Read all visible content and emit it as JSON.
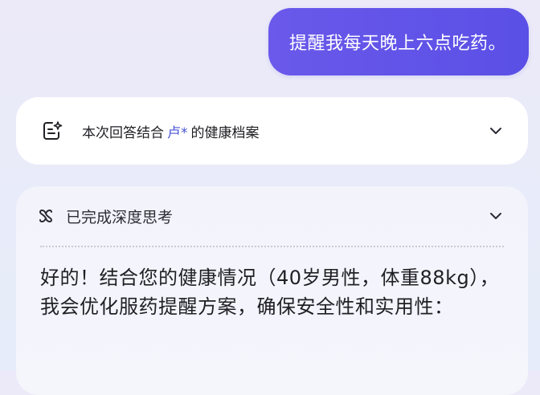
{
  "user_message": {
    "text": "提醒我每天晚上六点吃药。"
  },
  "context_card": {
    "prefix": "本次回答结合",
    "name": "卢*",
    "suffix": "的健康档案",
    "icon": "health-record-icon"
  },
  "thinking": {
    "label": "已完成深度思考",
    "icon": "deep-think-icon"
  },
  "answer": {
    "text": "好的！结合您的健康情况（40岁男性，体重88kg），我会优化服药提醒方案，确保安全性和实用性："
  },
  "colors": {
    "bubble_start": "#6a59ea",
    "bubble_end": "#5a4fe6",
    "accent_name": "#4a55d8",
    "think_accent": "#3d63c6"
  }
}
